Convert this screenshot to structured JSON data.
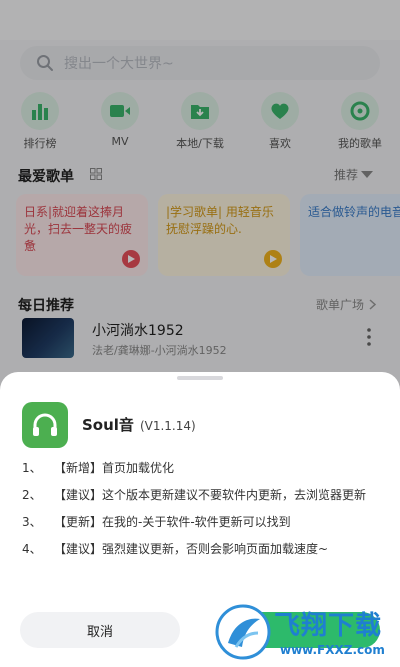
{
  "search": {
    "placeholder": "搜出一个大世界~"
  },
  "categories": [
    {
      "label": "排行榜",
      "icon": "bar-chart-icon"
    },
    {
      "label": "MV",
      "icon": "video-icon"
    },
    {
      "label": "本地/下载",
      "icon": "download-folder-icon"
    },
    {
      "label": "喜欢",
      "icon": "heart-icon"
    },
    {
      "label": "我的歌单",
      "icon": "disc-icon"
    }
  ],
  "favorites": {
    "title": "最爱歌单",
    "sort_label": "推荐",
    "cards": [
      {
        "text": "日系|就迎着这捧月光，扫去一整天的疲惫",
        "bg": "#fde9eb",
        "color": "#d94a55",
        "play": "#e8505b"
      },
      {
        "text": "|学习歌单| 用轻音乐抚慰浮躁的心.",
        "bg": "#fdf4df",
        "color": "#d39a1a",
        "play": "#f2b31e"
      },
      {
        "text": "适合做铃声的电音乐",
        "bg": "#e2eefb",
        "color": "#3a7cc9",
        "play": "#3a7cc9"
      }
    ]
  },
  "daily": {
    "title": "每日推荐",
    "plaza_label": "歌单广场",
    "song": {
      "title": "小河淌水1952",
      "subtitle": "法老/龚琳娜-小河淌水1952"
    }
  },
  "dialog": {
    "app_name": "Soul音",
    "version": "(V1.1.14)",
    "notes": [
      {
        "num": "1、",
        "text": "【新增】首页加载优化"
      },
      {
        "num": "2、",
        "text": "【建议】这个版本更新建议不要软件内更新，去浏览器更新"
      },
      {
        "num": "3、",
        "text": "【更新】在我的-关于软件-软件更新可以找到"
      },
      {
        "num": "4、",
        "text": "【建议】强烈建议更新，否则会影响页面加载速度~"
      }
    ],
    "cancel_label": "取消"
  },
  "watermark": {
    "brand": "飞翔下载",
    "url": "www.FXXZ.com"
  },
  "colors": {
    "accent": "#2dba6b",
    "icon_bg": "#dcefe3"
  }
}
